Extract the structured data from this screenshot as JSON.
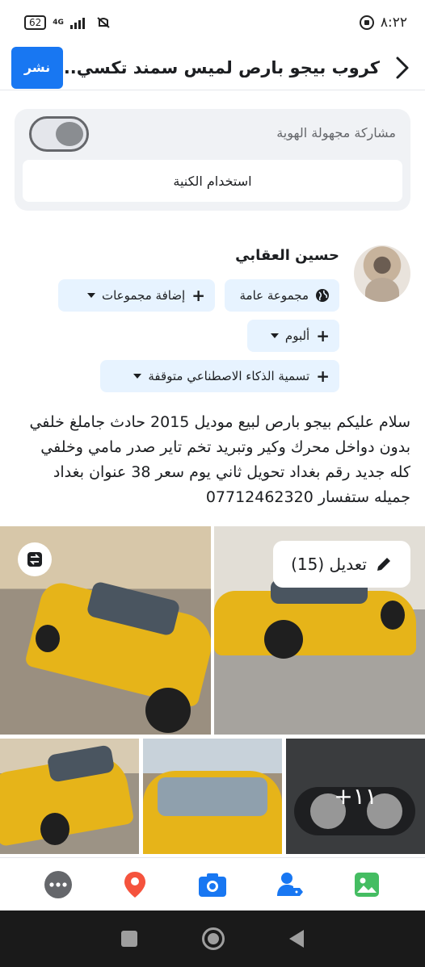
{
  "status_bar": {
    "battery": "62",
    "network": "4G",
    "time": "٨:٢٢"
  },
  "header": {
    "title": "كروب بيجو بارص لميس سمند تكسي...",
    "post_label": "نشر"
  },
  "anonymous": {
    "label": "مشاركة مجهولة الهوية",
    "toggle_on": false,
    "nickname_button": "استخدام الكنية"
  },
  "author": {
    "name": "حسين العقابي"
  },
  "audience_chips": {
    "public_group": "مجموعة عامة",
    "add_groups": "إضافة مجموعات",
    "album": "ألبوم",
    "ai_label": "تسمية الذكاء الاصطناعي متوقفة"
  },
  "post": {
    "text": "سلام عليكم بيجو بارص لبيع موديل 2015 حادث جاملغ خلفي بدون دواخل محرك وكير وتبريد تخم تاير صدر مامي وخلفي كله جديد رقم بغداد تحويل ثاني يوم سعر 38 عنوان بغداد جميله ستفسار 07712462320"
  },
  "photos": {
    "edit_label": "تعديل (15)",
    "more_count": "+١١"
  },
  "toolbar": {
    "icons": [
      "more-icon",
      "location-pin-icon",
      "camera-icon",
      "tag-people-icon",
      "photo-icon"
    ]
  },
  "colors": {
    "brand": "#1877f2",
    "chip_bg": "#e7f3ff",
    "card_bg": "#f0f2f5"
  }
}
